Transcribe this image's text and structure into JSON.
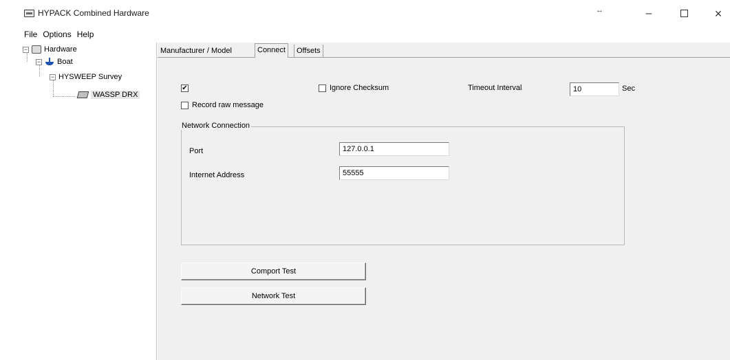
{
  "window": {
    "title": "HYPACK Combined Hardware",
    "minimize": "–",
    "close": "×",
    "resize_glyph": "↔"
  },
  "menu": [
    "File",
    "Options",
    "Help"
  ],
  "tree": {
    "root": "Hardware",
    "boat": "Boat",
    "survey": "HYSWEEP Survey",
    "device": "WASSP DRX",
    "expander_glyph": "−"
  },
  "tabs": [
    "Manufacturer / Model",
    "Connect",
    "Offsets"
  ],
  "connect": {
    "enabled_check": "✔",
    "ignore_checksum_label": "Ignore Checksum",
    "timeout_label": "Timeout Interval",
    "timeout_value": "10",
    "timeout_unit": "Sec",
    "record_raw_label": "Record raw message",
    "network_group_title": "Network Connection",
    "port_label": "Port",
    "port_value": "127.0.0.1",
    "internet_address_label": "Internet Address",
    "internet_address_value": "55555",
    "comport_test_label": "Comport Test",
    "network_test_label": "Network Test"
  },
  "icons": {
    "app": "hardware-icon",
    "root": "hardware-icon",
    "boat": "boat-icon",
    "device": "device-icon"
  }
}
